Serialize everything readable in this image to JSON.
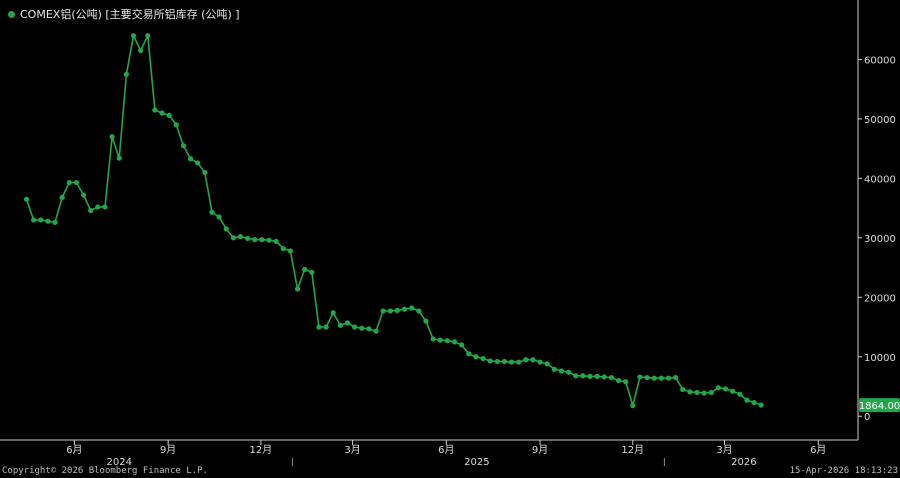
{
  "legend": {
    "label": "COMEX铝(公吨) [主要交易所铝库存 (公吨) ]",
    "color": "#1fa84a"
  },
  "footer": {
    "copyright": "Copyright© 2026 Bloomberg Finance L.P.",
    "timestamp": "15-Apr-2026 18:13:23"
  },
  "chart_data": {
    "type": "line",
    "series": [
      {
        "color": "#1fa84a",
        "last_value_label": "1864.00",
        "x": [
          "2024-04-15",
          "2024-04-22",
          "2024-04-29",
          "2024-05-06",
          "2024-05-13",
          "2024-05-20",
          "2024-05-27",
          "2024-06-03",
          "2024-06-10",
          "2024-06-17",
          "2024-06-24",
          "2024-07-01",
          "2024-07-08",
          "2024-07-15",
          "2024-07-22",
          "2024-07-29",
          "2024-08-05",
          "2024-08-12",
          "2024-08-19",
          "2024-08-26",
          "2024-09-02",
          "2024-09-09",
          "2024-09-16",
          "2024-09-23",
          "2024-09-30",
          "2024-10-07",
          "2024-10-14",
          "2024-10-21",
          "2024-10-28",
          "2024-11-04",
          "2024-11-11",
          "2024-11-18",
          "2024-11-25",
          "2024-12-02",
          "2024-12-09",
          "2024-12-16",
          "2024-12-23",
          "2024-12-30",
          "2025-01-06",
          "2025-01-13",
          "2025-01-20",
          "2025-01-27",
          "2025-02-03",
          "2025-02-10",
          "2025-02-17",
          "2025-02-24",
          "2025-03-03",
          "2025-03-10",
          "2025-03-17",
          "2025-03-24",
          "2025-03-31",
          "2025-04-07",
          "2025-04-14",
          "2025-04-21",
          "2025-04-28",
          "2025-05-05",
          "2025-05-12",
          "2025-05-19",
          "2025-05-26",
          "2025-06-02",
          "2025-06-09",
          "2025-06-16",
          "2025-06-23",
          "2025-06-30",
          "2025-07-07",
          "2025-07-14",
          "2025-07-21",
          "2025-07-28",
          "2025-08-04",
          "2025-08-11",
          "2025-08-18",
          "2025-08-25",
          "2025-09-01",
          "2025-09-08",
          "2025-09-15",
          "2025-09-22",
          "2025-09-29",
          "2025-10-06",
          "2025-10-13",
          "2025-10-20",
          "2025-10-27",
          "2025-11-03",
          "2025-11-10",
          "2025-11-17",
          "2025-11-24",
          "2025-12-01",
          "2025-12-08",
          "2025-12-15",
          "2025-12-22",
          "2025-12-29",
          "2026-01-05",
          "2026-01-12",
          "2026-01-19",
          "2026-01-26",
          "2026-02-02",
          "2026-02-09",
          "2026-02-16",
          "2026-02-23",
          "2026-03-02",
          "2026-03-09",
          "2026-03-16",
          "2026-03-23",
          "2026-03-30",
          "2026-04-06"
        ],
        "values": [
          36500,
          33000,
          33000,
          32800,
          32600,
          36800,
          39300,
          39300,
          37200,
          34600,
          35200,
          35200,
          47000,
          43400,
          57500,
          64000,
          61500,
          64000,
          51500,
          51000,
          50600,
          49000,
          45500,
          43300,
          42600,
          41000,
          34300,
          33500,
          31500,
          30000,
          30200,
          29900,
          29700,
          29700,
          29600,
          29400,
          28200,
          27800,
          21400,
          24700,
          24200,
          15000,
          15000,
          17400,
          15300,
          15700,
          15000,
          14800,
          14700,
          14300,
          17700,
          17700,
          17800,
          18000,
          18200,
          17700,
          16000,
          13000,
          12800,
          12700,
          12500,
          12000,
          10500,
          10000,
          9700,
          9300,
          9200,
          9200,
          9100,
          9100,
          9500,
          9500,
          9100,
          8800,
          7900,
          7600,
          7400,
          6800,
          6800,
          6700,
          6700,
          6600,
          6500,
          6000,
          5800,
          1800,
          6600,
          6500,
          6400,
          6400,
          6400,
          6500,
          4500,
          4100,
          4000,
          3900,
          4000,
          4800,
          4600,
          4200,
          3700,
          2700,
          2300,
          1864
        ]
      }
    ],
    "y_axis": {
      "side": "right",
      "ylim": [
        -4000,
        70000
      ],
      "ticks": [
        0,
        10000,
        20000,
        30000,
        40000,
        50000,
        60000
      ]
    },
    "x_axis": {
      "xlim": [
        "2024-03-20",
        "2026-07-10"
      ],
      "month_ticks": [
        {
          "date": "2024-06-01",
          "label": "6月"
        },
        {
          "date": "2024-09-01",
          "label": "9月"
        },
        {
          "date": "2024-12-01",
          "label": "12月"
        },
        {
          "date": "2025-03-01",
          "label": "3月"
        },
        {
          "date": "2025-06-01",
          "label": "6月"
        },
        {
          "date": "2025-09-01",
          "label": "9月"
        },
        {
          "date": "2025-12-01",
          "label": "12月"
        },
        {
          "date": "2026-03-01",
          "label": "3月"
        },
        {
          "date": "2026-06-01",
          "label": "6月"
        }
      ],
      "year_labels": [
        {
          "date": "2024-07-15",
          "label": "2024"
        },
        {
          "date": "2025-07-01",
          "label": "2025"
        },
        {
          "date": "2026-03-20",
          "label": "2026"
        }
      ],
      "year_separators": [
        "2025-01-01",
        "2026-01-01"
      ]
    },
    "grid": false,
    "legend": "top-left"
  }
}
